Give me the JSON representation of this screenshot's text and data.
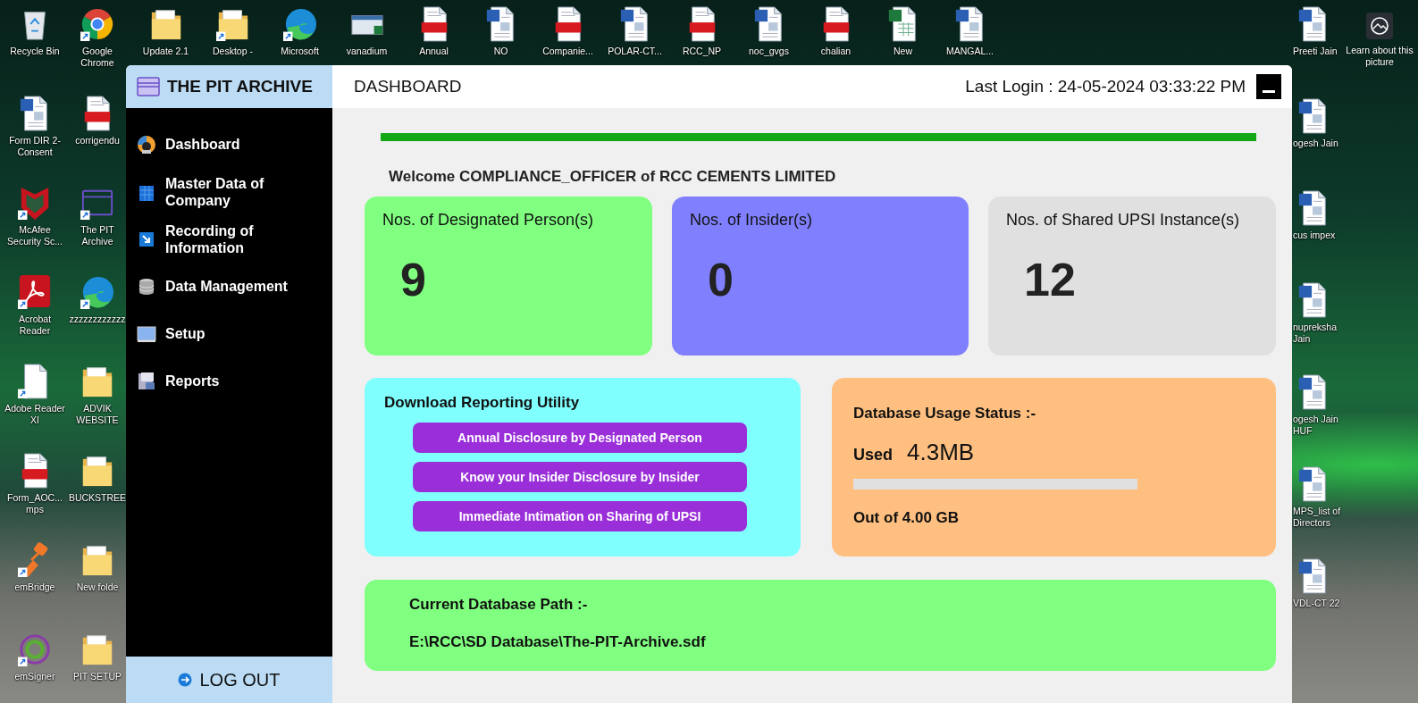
{
  "desktop": {
    "left_icons": [
      {
        "label": "Recycle Bin",
        "kind": "recycle",
        "shortcut": false
      },
      {
        "label": "Form DIR 2-Consent",
        "kind": "word",
        "shortcut": false
      },
      {
        "label": "McAfee Security Sc...",
        "kind": "mcafee",
        "shortcut": true
      },
      {
        "label": "Acrobat Reader",
        "kind": "acrobat",
        "shortcut": true
      },
      {
        "label": "Adobe Reader XI",
        "kind": "blank",
        "shortcut": true
      },
      {
        "label": "Form_AOC... mps",
        "kind": "pdf",
        "shortcut": false
      },
      {
        "label": "emBridge",
        "kind": "embridge",
        "shortcut": true
      },
      {
        "label": "emSigner",
        "kind": "emsigner",
        "shortcut": true
      },
      {
        "label": "Google Chrome",
        "kind": "chrome",
        "shortcut": true
      },
      {
        "label": "corrigendu",
        "kind": "pdf",
        "shortcut": false
      },
      {
        "label": "The PIT Archive",
        "kind": "pit",
        "shortcut": true
      },
      {
        "label": "zzzzzzzzzzzz",
        "kind": "edge",
        "shortcut": true
      },
      {
        "label": "ADVIK WEBSITE",
        "kind": "folder",
        "shortcut": false
      },
      {
        "label": "BUCKSTREE",
        "kind": "folder",
        "shortcut": false
      },
      {
        "label": "New folde",
        "kind": "folder",
        "shortcut": false
      },
      {
        "label": "PIT SETUP",
        "kind": "folder",
        "shortcut": false
      }
    ],
    "top_icons": [
      {
        "label": "Update 2.1",
        "kind": "folder",
        "shortcut": false
      },
      {
        "label": "Desktop -",
        "kind": "folder",
        "shortcut": true
      },
      {
        "label": "Microsoft",
        "kind": "edge",
        "shortcut": true
      },
      {
        "label": "vanadium",
        "kind": "app",
        "shortcut": false
      },
      {
        "label": "Annual",
        "kind": "pdf",
        "shortcut": false
      },
      {
        "label": "NO",
        "kind": "word",
        "shortcut": false
      },
      {
        "label": "Companie...",
        "kind": "pdf",
        "shortcut": false
      },
      {
        "label": "POLAR-CT...",
        "kind": "word",
        "shortcut": false
      },
      {
        "label": "RCC_NP",
        "kind": "pdf",
        "shortcut": false
      },
      {
        "label": "noc_gvgs",
        "kind": "word",
        "shortcut": false
      },
      {
        "label": "chalian",
        "kind": "pdf",
        "shortcut": false
      },
      {
        "label": "New",
        "kind": "excel",
        "shortcut": false
      },
      {
        "label": "MANGAL...",
        "kind": "word",
        "shortcut": false
      }
    ],
    "right_icons": [
      {
        "label": "Preeti Jain",
        "kind": "word",
        "shortcut": false
      },
      {
        "label": "ogesh Jain",
        "kind": "word",
        "shortcut": false
      },
      {
        "label": "cus impex",
        "kind": "word",
        "shortcut": false
      },
      {
        "label": "nupreksha Jain",
        "kind": "word",
        "shortcut": false
      },
      {
        "label": "ogesh Jain HUF",
        "kind": "word",
        "shortcut": false
      },
      {
        "label": "MPS_list of Directors",
        "kind": "word",
        "shortcut": false
      },
      {
        "label": "VDL-CT 22",
        "kind": "word",
        "shortcut": false
      }
    ],
    "learn_about": {
      "label": "Learn about this picture"
    }
  },
  "app": {
    "title": "THE PIT ARCHIVE",
    "page_title": "DASHBOARD",
    "last_login": "Last Login : 24-05-2024 03:33:22 PM",
    "sidebar": [
      {
        "label": "Dashboard",
        "kind": "dashboard"
      },
      {
        "label": "Master Data of Company",
        "kind": "company"
      },
      {
        "label": "Recording of Information",
        "kind": "recording"
      },
      {
        "label": "Data Management",
        "kind": "data"
      },
      {
        "label": "Setup",
        "kind": "setup"
      },
      {
        "label": "Reports",
        "kind": "reports"
      }
    ],
    "logout": "LOG OUT",
    "welcome": "Welcome COMPLIANCE_OFFICER of RCC CEMENTS LIMITED",
    "stats": [
      {
        "label": "Nos. of Designated Person(s)",
        "value": "9",
        "color": "#80ff80"
      },
      {
        "label": "Nos. of Insider(s)",
        "value": "0",
        "color": "#8080ff"
      },
      {
        "label": "Nos. of Shared UPSI Instance(s)",
        "value": "12",
        "color": "#e0e0e0"
      }
    ],
    "reporting": {
      "title": "Download Reporting Utility",
      "buttons": [
        "Annual Disclosure by Designated Person",
        "Know your Insider Disclosure by Insider",
        "Immediate Intimation on Sharing of UPSI"
      ]
    },
    "usage": {
      "title": "Database Usage Status :-",
      "used_label": "Used",
      "used_value": "4.3MB",
      "level": 0,
      "total": "Out of 4.00 GB"
    },
    "path": {
      "title": "Current Database Path :-",
      "value": "E:\\RCC\\SD Database\\The-PIT-Archive.sdf"
    }
  }
}
